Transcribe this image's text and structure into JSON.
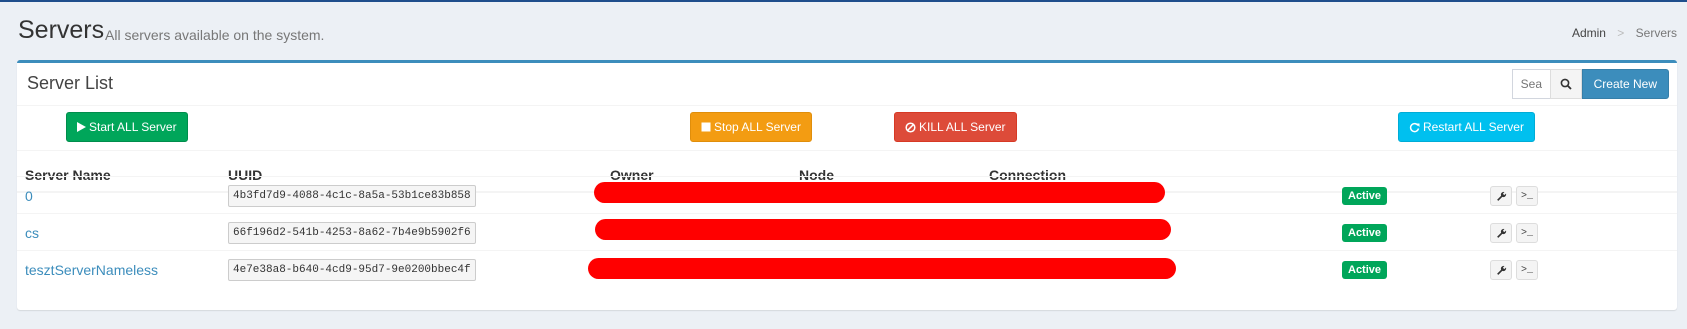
{
  "header": {
    "title": "Servers",
    "subtitle": "All servers available on the system.",
    "breadcrumb": {
      "root": "Admin",
      "separator": ">",
      "current": "Servers"
    }
  },
  "box": {
    "title": "Server List",
    "search_placeholder": "Search",
    "create_label": "Create New"
  },
  "actions": {
    "start": "Start ALL Server",
    "stop": "Stop ALL Server",
    "kill": "KILL ALL Server",
    "restart": "Restart ALL Server"
  },
  "table": {
    "headers": [
      "Server Name",
      "UUID",
      "Owner",
      "Node",
      "Connection"
    ],
    "rows": [
      {
        "name": "0",
        "uuid": "4b3fd7d9-4088-4c1c-8a5a-53b1ce83b858",
        "status": "Active"
      },
      {
        "name": "cs",
        "uuid": "66f196d2-541b-4253-8a62-7b4e9b5902f6",
        "status": "Active"
      },
      {
        "name": "tesztServerNameless",
        "uuid": "4e7e38a8-b640-4cd9-95d7-9e0200bbec4f",
        "status": "Active"
      }
    ]
  },
  "colors": {
    "primary": "#3c8dbc",
    "success": "#00a65a",
    "warning": "#f39c12",
    "danger": "#dd4b39",
    "info": "#00c0ef",
    "redaction": "#ff0000"
  },
  "icons": {
    "start": "play-icon",
    "stop": "stop-square-icon",
    "kill": "ban-icon",
    "restart": "refresh-icon",
    "search": "search-icon",
    "manage": "wrench-icon",
    "console": "terminal-icon"
  }
}
